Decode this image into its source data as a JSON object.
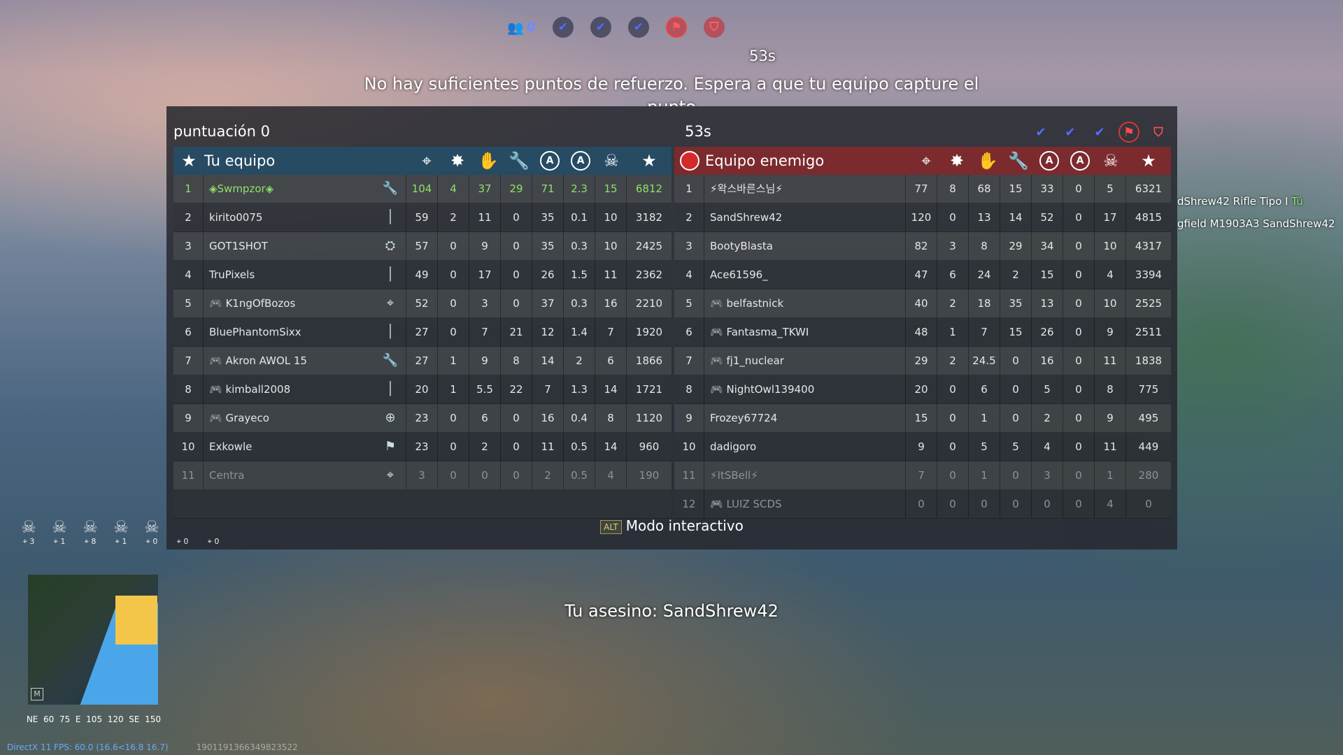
{
  "hud": {
    "players_count": "0",
    "timer": "53s",
    "message": "No hay suficientes puntos de refuerzo. Espera a que tu equipo capture el punto",
    "flags": [
      "check-icon",
      "check-icon",
      "check-icon",
      "enemy-flag-icon",
      "shield-icon"
    ],
    "killer": "Tu asesino: SandShrew42",
    "interactive_key": "ALT",
    "interactive_label": "Modo interactivo",
    "fps": "DirectX 11 FPS: 60.0 (16.6<16.8 16.7)",
    "session_id": "1901191366349823522",
    "minimap_key": "M",
    "compass": [
      "NE",
      "60",
      "75",
      "E",
      "105",
      "120",
      "SE",
      "150"
    ]
  },
  "panel": {
    "score_label": "puntuación 0",
    "timer": "53s"
  },
  "killfeed": [
    {
      "victim": "dShrew42",
      "weapon": "Rifle Tipo I",
      "killer": "Tú"
    },
    {
      "victim": "gfield M1903A3",
      "weapon": "",
      "killer": "SandShrew42"
    }
  ],
  "squad": [
    "3",
    "1",
    "8",
    "1",
    "0",
    "0",
    "0"
  ],
  "colors": {
    "our_team": "#264b63",
    "enemy_team": "#7b2a2e",
    "self": "#8fe06a"
  },
  "our_team": {
    "name": "Tu equipo",
    "columns": [
      "target-icon",
      "bomb-icon",
      "hand-icon",
      "wrench-icon",
      "shield-a-icon",
      "a-icon",
      "skull-icon",
      "star-icon"
    ],
    "rows": [
      {
        "rank": "1",
        "name": "◈Swmpzor◈",
        "cls": "wrench",
        "stats": [
          "104",
          "4",
          "37",
          "29",
          "71",
          "2.3",
          "15",
          "6812"
        ],
        "me": true
      },
      {
        "rank": "2",
        "name": "kirito0075",
        "cls": "rifle",
        "stats": [
          "59",
          "2",
          "11",
          "0",
          "35",
          "0.1",
          "10",
          "3182"
        ]
      },
      {
        "rank": "3",
        "name": "GOT1SHOT",
        "cls": "tank",
        "stats": [
          "57",
          "0",
          "9",
          "0",
          "35",
          "0.3",
          "10",
          "2425"
        ]
      },
      {
        "rank": "4",
        "name": "TruPixels",
        "cls": "rifle",
        "stats": [
          "49",
          "0",
          "17",
          "0",
          "26",
          "1.5",
          "11",
          "2362"
        ]
      },
      {
        "rank": "5",
        "name": "🎮 K1ngOfBozos",
        "cls": "target",
        "stats": [
          "52",
          "0",
          "3",
          "0",
          "37",
          "0.3",
          "16",
          "2210"
        ]
      },
      {
        "rank": "6",
        "name": "BluePhantomSixx",
        "cls": "rifle",
        "stats": [
          "27",
          "0",
          "7",
          "21",
          "12",
          "1.4",
          "7",
          "1920"
        ]
      },
      {
        "rank": "7",
        "name": "🎮 Akron AWOL 15",
        "cls": "wrench",
        "stats": [
          "27",
          "1",
          "9",
          "8",
          "14",
          "2",
          "6",
          "1866"
        ]
      },
      {
        "rank": "8",
        "name": "🎮 kimball2008",
        "cls": "rifle",
        "stats": [
          "20",
          "1",
          "5.5",
          "22",
          "7",
          "1.3",
          "14",
          "1721"
        ]
      },
      {
        "rank": "9",
        "name": "🎮 Grayeco",
        "cls": "medic",
        "stats": [
          "23",
          "0",
          "6",
          "0",
          "16",
          "0.4",
          "8",
          "1120"
        ]
      },
      {
        "rank": "10",
        "name": "Exkowle",
        "cls": "squad",
        "stats": [
          "23",
          "0",
          "2",
          "0",
          "11",
          "0.5",
          "14",
          "960"
        ]
      },
      {
        "rank": "11",
        "name": "Centra",
        "cls": "target",
        "stats": [
          "3",
          "0",
          "0",
          "0",
          "2",
          "0.5",
          "4",
          "190"
        ],
        "dim": true
      }
    ]
  },
  "enemy_team": {
    "name": "Equipo enemigo",
    "columns": [
      "target-icon",
      "bomb-icon",
      "hand-icon",
      "wrench-icon",
      "shield-a-icon",
      "a-icon",
      "skull-icon",
      "star-icon"
    ],
    "rows": [
      {
        "rank": "1",
        "name": "⚡왁스바른스님⚡",
        "stats": [
          "77",
          "8",
          "68",
          "15",
          "33",
          "0",
          "5",
          "6321"
        ]
      },
      {
        "rank": "2",
        "name": "SandShrew42",
        "stats": [
          "120",
          "0",
          "13",
          "14",
          "52",
          "0",
          "17",
          "4815"
        ]
      },
      {
        "rank": "3",
        "name": "BootyBlasta",
        "stats": [
          "82",
          "3",
          "8",
          "29",
          "34",
          "0",
          "10",
          "4317"
        ]
      },
      {
        "rank": "4",
        "name": "Ace61596_",
        "stats": [
          "47",
          "6",
          "24",
          "2",
          "15",
          "0",
          "4",
          "3394"
        ]
      },
      {
        "rank": "5",
        "name": "🎮 belfastnick",
        "stats": [
          "40",
          "2",
          "18",
          "35",
          "13",
          "0",
          "10",
          "2525"
        ]
      },
      {
        "rank": "6",
        "name": "🎮 Fantasma_TKWI",
        "stats": [
          "48",
          "1",
          "7",
          "15",
          "26",
          "0",
          "9",
          "2511"
        ]
      },
      {
        "rank": "7",
        "name": "🎮 fj1_nuclear",
        "stats": [
          "29",
          "2",
          "24.5",
          "0",
          "16",
          "0",
          "11",
          "1838"
        ]
      },
      {
        "rank": "8",
        "name": "🎮 NightOwl139400",
        "stats": [
          "20",
          "0",
          "6",
          "0",
          "5",
          "0",
          "8",
          "775"
        ]
      },
      {
        "rank": "9",
        "name": "Frozey67724",
        "stats": [
          "15",
          "0",
          "1",
          "0",
          "2",
          "0",
          "9",
          "495"
        ]
      },
      {
        "rank": "10",
        "name": "dadigoro",
        "stats": [
          "9",
          "0",
          "5",
          "5",
          "4",
          "0",
          "11",
          "449"
        ]
      },
      {
        "rank": "11",
        "name": "⚡ItSBell⚡",
        "stats": [
          "7",
          "0",
          "1",
          "0",
          "3",
          "0",
          "1",
          "280"
        ],
        "dim": true
      },
      {
        "rank": "12",
        "name": "🎮 LUIZ SCDS",
        "stats": [
          "0",
          "0",
          "0",
          "0",
          "0",
          "0",
          "4",
          "0"
        ],
        "dim": true
      }
    ]
  }
}
